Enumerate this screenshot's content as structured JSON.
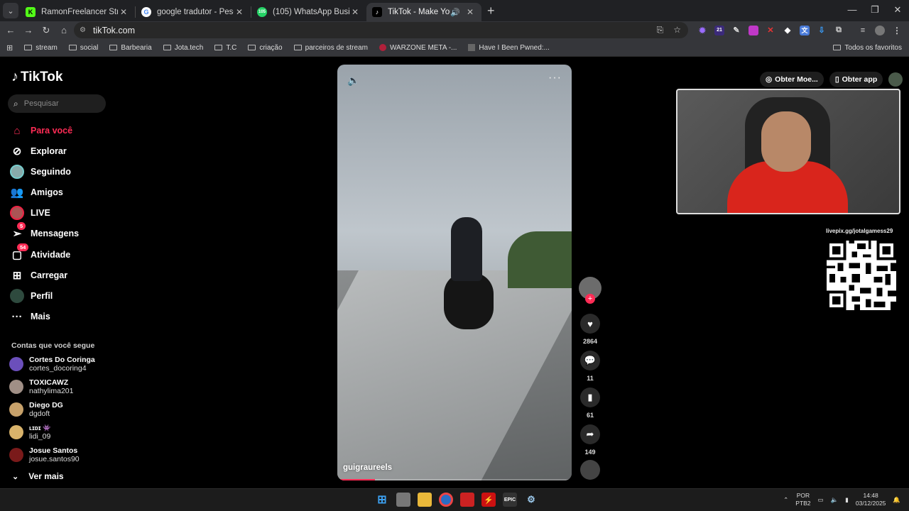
{
  "browser": {
    "tabs": [
      {
        "title": "RamonFreelancer Stream - Wat",
        "favicon_color": "#53fc18",
        "favicon_letter": "K"
      },
      {
        "title": "google tradutor - Pesquisa Goo",
        "favicon_color": "#ffffff",
        "favicon_letter": "G"
      },
      {
        "title": "(105) WhatsApp Business",
        "favicon_color": "#25d366",
        "favicon_letter": "105"
      },
      {
        "title": "TikTok - Make Your Day",
        "favicon_color": "#000000",
        "favicon_letter": "♪",
        "active": true
      }
    ],
    "url": "tikTok.com",
    "bookmarks": [
      "stream",
      "social",
      "Barbearia",
      "Jota.tech",
      "T.C",
      "criação",
      "parceiros de stream",
      "WARZONE META -...",
      "Have I Been Pwned:..."
    ],
    "all_bookmarks": "Todos os favoritos",
    "extension_badge": "21"
  },
  "tiktok": {
    "logo": "TikTok",
    "search_placeholder": "Pesquisar",
    "nav": [
      {
        "label": "Para você",
        "icon": "home-icon",
        "active": true
      },
      {
        "label": "Explorar",
        "icon": "compass-icon"
      },
      {
        "label": "Seguindo",
        "icon": "following-avatar-icon"
      },
      {
        "label": "Amigos",
        "icon": "friends-icon"
      },
      {
        "label": "LIVE",
        "icon": "live-avatar-icon"
      },
      {
        "label": "Mensagens",
        "icon": "message-icon",
        "badge": "5"
      },
      {
        "label": "Atividade",
        "icon": "activity-icon",
        "badge": "54"
      },
      {
        "label": "Carregar",
        "icon": "upload-icon"
      },
      {
        "label": "Perfil",
        "icon": "profile-avatar-icon"
      },
      {
        "label": "Mais",
        "icon": "more-icon"
      }
    ],
    "following_title": "Contas que você segue",
    "accounts": [
      {
        "name": "Cortes Do Coringa",
        "handle": "cortes_docoring4",
        "color": "#6b4fbb"
      },
      {
        "name": "TOXICAWZ",
        "handle": "nathylima201",
        "color": "#a08f86"
      },
      {
        "name": "Diego DG",
        "handle": "dgdoft",
        "color": "#c7a16a"
      },
      {
        "name": "ʟɪᴅɪ 👾",
        "handle": "lidi_09",
        "color": "#d9b36b"
      },
      {
        "name": "Josue Santos",
        "handle": "josue.santos90",
        "color": "#7a1a1a"
      }
    ],
    "see_more": "Ver mais",
    "video": {
      "author": "guigraureels",
      "progress": 0.16
    },
    "actions": {
      "likes": "2864",
      "comments": "11",
      "saves": "61",
      "shares": "149"
    },
    "top_right": {
      "coins": "Obter Moe...",
      "get_app": "Obter app"
    }
  },
  "overlay": {
    "qr_label": "livepix.gg/jotalgamess29"
  },
  "taskbar": {
    "lang": "POR",
    "layout": "PTB2",
    "time": "14:48",
    "date": "03/12/2025"
  }
}
